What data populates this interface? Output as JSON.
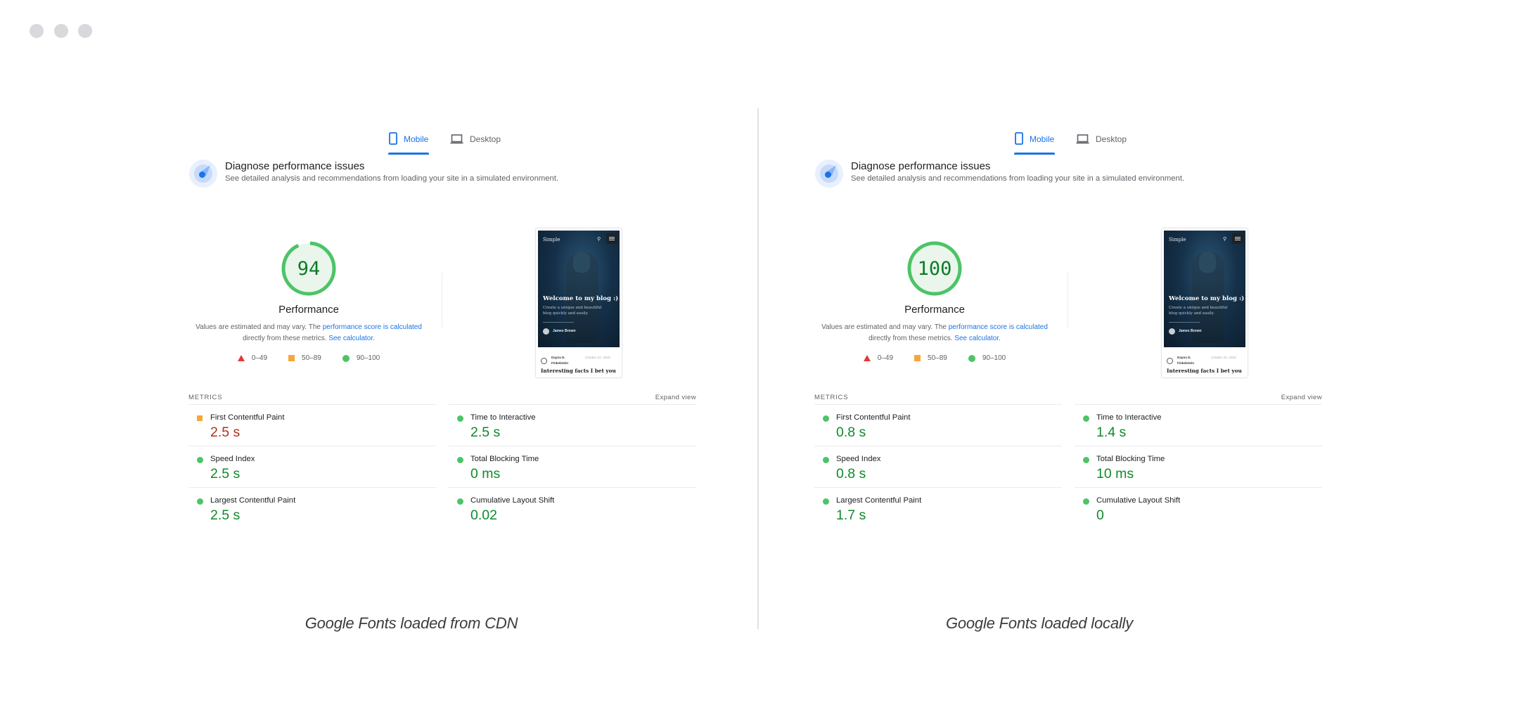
{
  "window": {
    "controls": [
      "close",
      "minimize",
      "maximize"
    ]
  },
  "colors": {
    "accent": "#1a73e8",
    "pass": "#0d8a2a",
    "pass_indicator": "#4cc467",
    "average": "#f4a83a",
    "average_value_text": "#b3321a",
    "fail": "#e53935"
  },
  "panels": [
    {
      "id": "cdn",
      "tabs": [
        {
          "label": "Mobile",
          "icon": "smartphone-icon",
          "active": true
        },
        {
          "label": "Desktop",
          "icon": "laptop-icon",
          "active": false
        }
      ],
      "diagnose": {
        "title": "Diagnose performance issues",
        "subtitle": "See detailed analysis and recommendations from loading your site in a simulated environment."
      },
      "score": {
        "value": "94",
        "fraction": 0.94,
        "label": "Performance",
        "desc_prefix": "Values are estimated and may vary. The ",
        "desc_link1": "performance score is calculated",
        "desc_middle": "directly from these metrics. ",
        "desc_link2": "See calculator."
      },
      "legend": [
        {
          "range": "0–49",
          "shape": "triangle",
          "level": "fail"
        },
        {
          "range": "50–89",
          "shape": "square",
          "level": "average"
        },
        {
          "range": "90–100",
          "shape": "circle",
          "level": "pass"
        }
      ],
      "thumbnail": {
        "brand": "Simple",
        "hero_title": "Welcome to my blog :)",
        "hero_subtitle": "Create a unique and beautiful blog quickly and easily.",
        "hero_author": "James Brown",
        "card_author": "Dayna D. Finkelstein",
        "card_date": "October 22, 2018",
        "card_title": "Interesting facts I bet you"
      },
      "metrics": {
        "title": "METRICS",
        "expand_label": "Expand view",
        "columns": [
          [
            {
              "name": "First Contentful Paint",
              "value": "2.5 s",
              "level": "average"
            },
            {
              "name": "Speed Index",
              "value": "2.5 s",
              "level": "pass"
            },
            {
              "name": "Largest Contentful Paint",
              "value": "2.5 s",
              "level": "pass"
            }
          ],
          [
            {
              "name": "Time to Interactive",
              "value": "2.5 s",
              "level": "pass"
            },
            {
              "name": "Total Blocking Time",
              "value": "0 ms",
              "level": "pass"
            },
            {
              "name": "Cumulative Layout Shift",
              "value": "0.02",
              "level": "pass"
            }
          ]
        ]
      },
      "caption": "Google Fonts loaded from CDN"
    },
    {
      "id": "local",
      "tabs": [
        {
          "label": "Mobile",
          "icon": "smartphone-icon",
          "active": true
        },
        {
          "label": "Desktop",
          "icon": "laptop-icon",
          "active": false
        }
      ],
      "diagnose": {
        "title": "Diagnose performance issues",
        "subtitle": "See detailed analysis and recommendations from loading your site in a simulated environment."
      },
      "score": {
        "value": "100",
        "fraction": 1.0,
        "label": "Performance",
        "desc_prefix": "Values are estimated and may vary. The ",
        "desc_link1": "performance score is calculated",
        "desc_middle": "directly from these metrics. ",
        "desc_link2": "See calculator."
      },
      "legend": [
        {
          "range": "0–49",
          "shape": "triangle",
          "level": "fail"
        },
        {
          "range": "50–89",
          "shape": "square",
          "level": "average"
        },
        {
          "range": "90–100",
          "shape": "circle",
          "level": "pass"
        }
      ],
      "thumbnail": {
        "brand": "Simple",
        "hero_title": "Welcome to my blog :)",
        "hero_subtitle": "Create a unique and beautiful blog quickly and easily.",
        "hero_author": "James Brown",
        "card_author": "Dayna D. Finkelstein",
        "card_date": "October 22, 2018",
        "card_title": "Interesting facts I bet you"
      },
      "metrics": {
        "title": "METRICS",
        "expand_label": "Expand view",
        "columns": [
          [
            {
              "name": "First Contentful Paint",
              "value": "0.8 s",
              "level": "pass"
            },
            {
              "name": "Speed Index",
              "value": "0.8 s",
              "level": "pass"
            },
            {
              "name": "Largest Contentful Paint",
              "value": "1.7 s",
              "level": "pass"
            }
          ],
          [
            {
              "name": "Time to Interactive",
              "value": "1.4 s",
              "level": "pass"
            },
            {
              "name": "Total Blocking Time",
              "value": "10 ms",
              "level": "pass"
            },
            {
              "name": "Cumulative Layout Shift",
              "value": "0",
              "level": "pass"
            }
          ]
        ]
      },
      "caption": "Google Fonts loaded locally"
    }
  ]
}
